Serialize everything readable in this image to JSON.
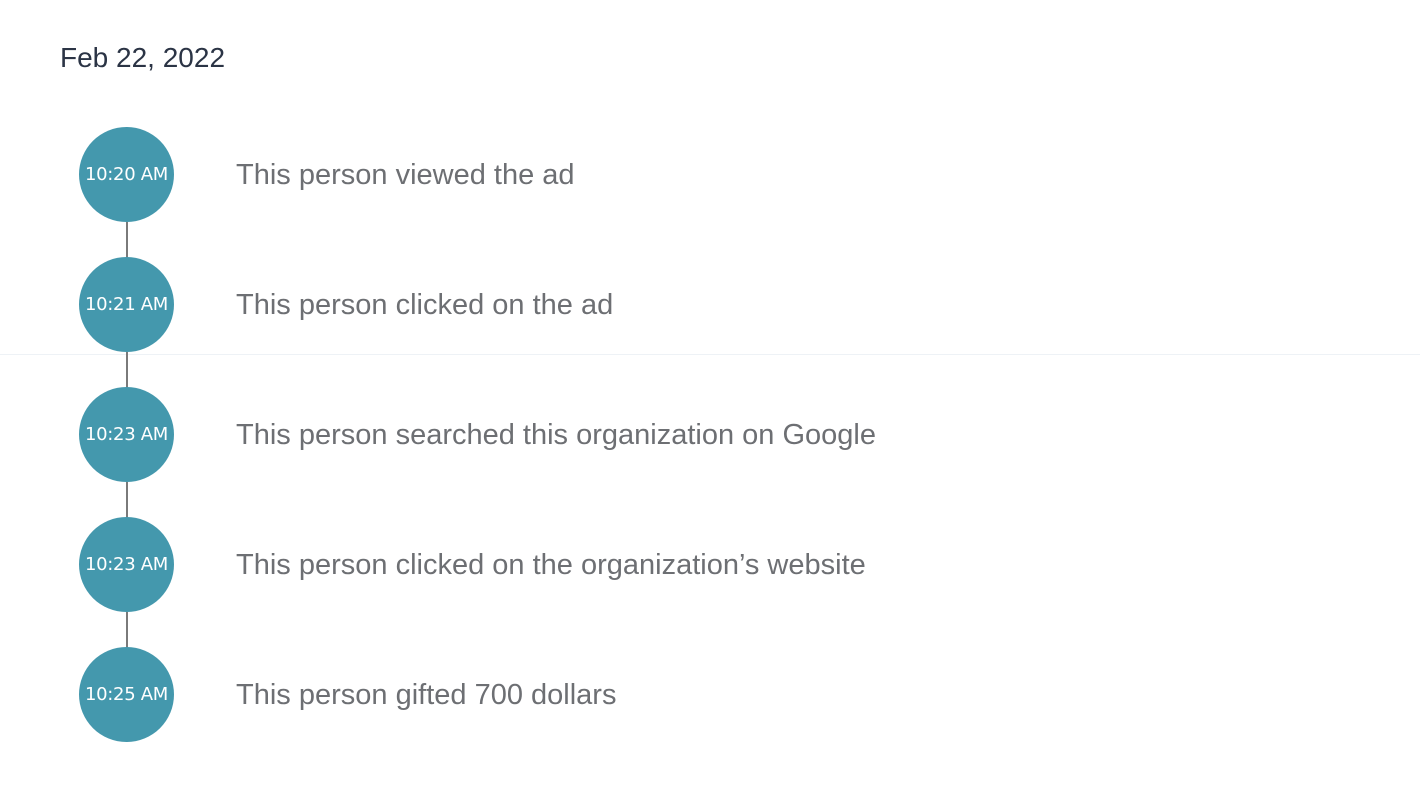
{
  "date": "Feb 22, 2022",
  "events": [
    {
      "time": "10:20 AM",
      "text": "This person viewed the ad"
    },
    {
      "time": "10:21 AM",
      "text": "This person clicked on the ad"
    },
    {
      "time": "10:23 AM",
      "text": "This person searched this organization on Google"
    },
    {
      "time": "10:23 AM",
      "text": "This person clicked on the organization’s website"
    },
    {
      "time": "10:25 AM",
      "text": "This person gifted 700 dollars"
    }
  ],
  "colors": {
    "circle": "#4498ad",
    "connector": "#7a7a7a",
    "event_text": "#6d6f73",
    "date_text": "#2b3445"
  }
}
